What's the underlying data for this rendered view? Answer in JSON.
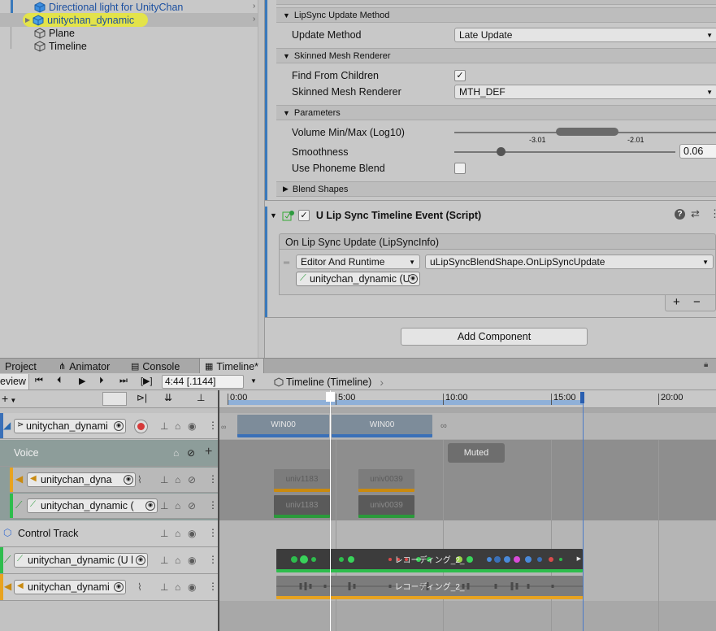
{
  "hierarchy": {
    "items": [
      {
        "label": "Directional light for UnityChan",
        "icon": "blue-cube-icon"
      },
      {
        "label": "unitychan_dynamic",
        "icon": "prefab-cube-icon",
        "selected": true
      },
      {
        "label": "Plane",
        "icon": "gameobject-cube-icon"
      },
      {
        "label": "Timeline",
        "icon": "gameobject-cube-icon"
      }
    ]
  },
  "inspector": {
    "lipsync_section": "LipSync Update Method",
    "update_method_label": "Update Method",
    "update_method_value": "Late Update",
    "skinned_section": "Skinned Mesh Renderer",
    "find_children_label": "Find From Children",
    "find_children_checked": "✓",
    "skinned_mesh_label": "Skinned Mesh Renderer",
    "skinned_mesh_value": "MTH_DEF",
    "parameters_section": "Parameters",
    "volume_label": "Volume Min/Max (Log10)",
    "volume_min": "-3.01",
    "volume_max": "-2.01",
    "smoothness_label": "Smoothness",
    "smoothness_value": "0.06",
    "phoneme_label": "Use Phoneme Blend",
    "blendshapes_section": "Blend Shapes",
    "component_title": "U Lip Sync Timeline Event (Script)",
    "component_checked": "✓",
    "event_header": "On Lip Sync Update (LipSyncInfo)",
    "runtime_value": "Editor And Runtime",
    "function_value": "uLipSyncBlendShape.OnLipSyncUpdate",
    "target_object": "unitychan_dynamic (U",
    "plus_label": "+",
    "minus_label": "−",
    "add_component": "Add Component"
  },
  "tabs": [
    {
      "label": "Project",
      "icon": "folder-icon"
    },
    {
      "label": "Animator",
      "icon": "animator-icon"
    },
    {
      "label": "Console",
      "icon": "console-icon"
    },
    {
      "label": "Timeline*",
      "icon": "timeline-icon"
    }
  ],
  "toolbar": {
    "preview_label": "eview",
    "timecode": "4:44 [.1144]",
    "breadcrumb": "Timeline (Timeline)"
  },
  "ruler": {
    "labels": [
      "0:00",
      "5:00",
      "10:00",
      "15:00",
      "20:00"
    ]
  },
  "tracks": {
    "animation_binding": "unitychan_dynami",
    "voice_group": "Voice",
    "muted_label": "Muted",
    "voice_audio_binding": "unitychan_dyna",
    "voice_lipsync_binding": "unitychan_dynamic (",
    "control_track": "Control Track",
    "lipsync_binding": "unitychan_dynamic (U l",
    "audio_binding": "unitychan_dynami"
  },
  "clips": {
    "anim1": "WIN00",
    "anim2": "WIN00",
    "voice_a1": "univ1183",
    "voice_a2": "univ0039",
    "voice_l1": "univ1183",
    "voice_l2": "univ0039",
    "lipsync_clip": "レコーディング_2_",
    "audio_clip": "レコーディング_2_"
  },
  "colors": {
    "selection_highlight": "#e3e34a",
    "accent_blue": "#3a79bb",
    "audio_track": "#e8a320",
    "lipsync_track": "#2ebd4d",
    "animation_clip_bar": "#3a70b8"
  }
}
